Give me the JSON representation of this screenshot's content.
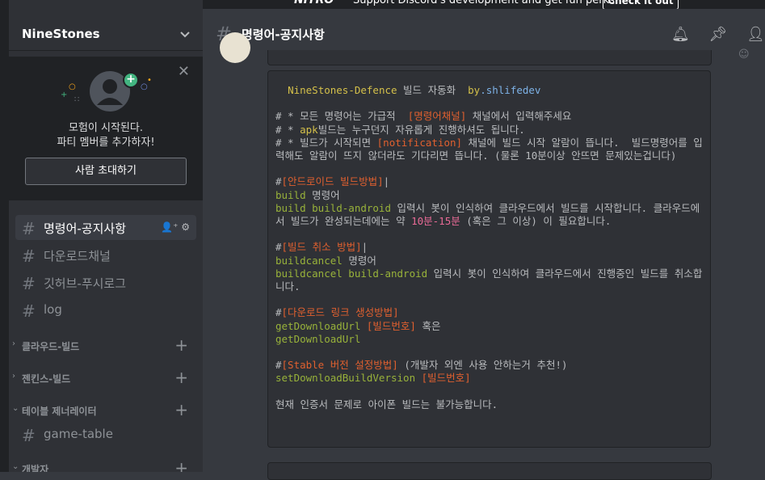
{
  "banner": {
    "brand": "NITRO",
    "message": "Support Discord's development and get fun perks!",
    "cta": "Check it out"
  },
  "guild": {
    "name": "NineStones"
  },
  "invite": {
    "line1": "모험이 시작된다.",
    "line2": "파티 멤버를 추가하자!",
    "button": "사람 초대하기"
  },
  "channels": [
    {
      "name": "명령어-공지사항",
      "active": true
    },
    {
      "name": "다운로드채널"
    },
    {
      "name": "깃허브-푸시로그"
    },
    {
      "name": "log"
    }
  ],
  "categories": [
    {
      "name": "클라우드-빌드",
      "collapsed": true
    },
    {
      "name": "젠킨스-빌드",
      "collapsed": true
    },
    {
      "name": "테이블 제너레이터",
      "collapsed": false
    },
    {
      "name": "개발자",
      "collapsed": false
    }
  ],
  "category_channels": [
    {
      "name": "game-table"
    }
  ],
  "header": {
    "channel_name": "명령어-공지사항"
  },
  "code": {
    "title_a": "NineStones-Defence",
    "title_b": " 빌드 자동화  ",
    "title_c": "by",
    "title_d": ".shlifedev",
    "r1_hash": "# * 모든 명령어는 가급적  ",
    "r1_tag": "[명령어채널]",
    "r1_rest": " 채널에서 입력해주세요",
    "r2_hash": "# * ",
    "r2_apk": "apk",
    "r2_rest": "빌드는 누구던지 자유롭게 진행하셔도 됩니다.",
    "r3_hash": "# * 빌드가 시작되면 ",
    "r3_tag": "[notification]",
    "r3_rest": " 채널에 빌드 시작 알람이 뜹니다.  빌드명령어를 입력해도 알람이 뜨지 않더라도 기다리면 뜹니다. (물론 10분이상 안뜨면 문제있는겁니다)",
    "s1_hash": "#",
    "s1_tag": "[안드로이드 빌드방법]",
    "s1_bar": "|",
    "s1_l1_cmd": "build",
    "s1_l1_rest": " 명령어",
    "s1_l2_cmd": "build build-android",
    "s1_l2_rest_a": " 입력시 봇이 인식하여 클라우드에서 빌드를 시작합니다. 클라우드에서 빌드가 완성되는데에는 약 ",
    "s1_l2_num": "10분-15분",
    "s1_l2_rest_b": " (혹은 그 이상) 이 필요합니다.",
    "s2_hash": "#",
    "s2_tag": "[빌드 취소 방법]",
    "s2_bar": "|",
    "s2_l1_cmd": "buildcancel",
    "s2_l1_rest": " 명령어",
    "s2_l2_cmd": "buildcancel build-android",
    "s2_l2_rest": " 입력시 봇이 인식하여 클라우드에서 진행중인 빌드를 취소합니다.",
    "s3_hash": "#",
    "s3_tag": "[다운로드 링크 생성방법]",
    "s3_l1_cmd": "getDownloadUrl",
    "s3_l1_tag": " [빌드번호]",
    "s3_l1_rest": " 혹은",
    "s3_l2_cmd": "getDownloadUrl",
    "s4_hash": "#",
    "s4_tag": "[Stable 버전 설정방법]",
    "s4_rest": " (개발자 외엔 사용 안하는거 추천!)",
    "s4_l1_cmd": "setDownloadBuildVersion",
    "s4_l1_tag": " [빌드번호]",
    "footer": "현재 인증서 문제로 아이폰 빌드는 불가능합니다."
  }
}
